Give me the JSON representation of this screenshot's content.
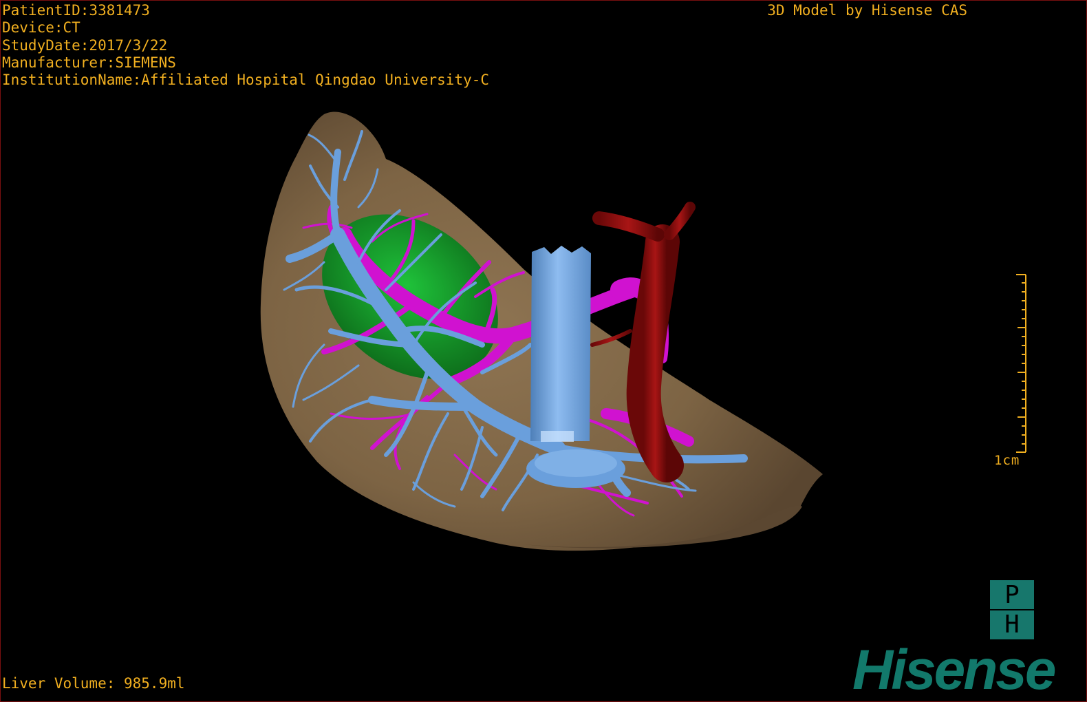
{
  "patient_info": {
    "patient_id": "PatientID:3381473",
    "device": "Device:CT",
    "study_date": "StudyDate:2017/3/22",
    "manufacturer": "Manufacturer:SIEMENS",
    "institution": "InstitutionName:Affiliated Hospital Qingdao University-C"
  },
  "credit": "3D Model by Hisense CAS",
  "scale_bar": {
    "label": "1cm"
  },
  "orientation_cube": {
    "top_letter": "P",
    "bottom_letter": "H"
  },
  "liver_volume": "Liver Volume: 985.9ml",
  "brand_logo": "Hisense",
  "colors": {
    "overlay_text": "#f2b020",
    "liver": "#7d6444",
    "portal_vein": "#6a9fdc",
    "hepatic_vein": "#d012d0",
    "artery_ivc": "#8a0c0c",
    "gallbladder": "#119a22",
    "brand": "#12796b"
  },
  "model_structures": [
    "liver",
    "hepatic-vein",
    "portal-vein",
    "gallbladder",
    "inferior-vena-cava"
  ]
}
